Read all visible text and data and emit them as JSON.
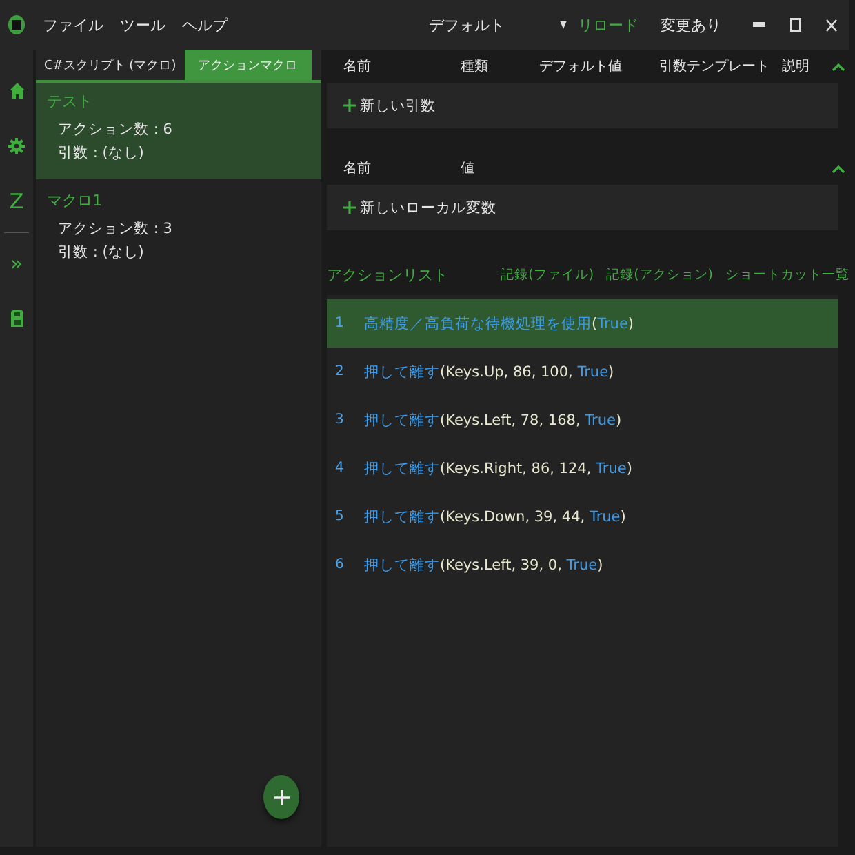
{
  "title_bar": {
    "menu": [
      "ファイル",
      "ツール",
      "ヘルプ"
    ],
    "title": "デフォルト",
    "reload": "リロード",
    "status": "変更あり"
  },
  "rail": [
    {
      "kind": "home"
    },
    {
      "kind": "gear"
    },
    {
      "kind": "letter",
      "text": "Z"
    },
    {
      "kind": "divider"
    },
    {
      "kind": "letter",
      "text": "»"
    },
    {
      "kind": "save"
    }
  ],
  "tabs": [
    {
      "label": "C#スクリプト (マクロ)",
      "selected": false
    },
    {
      "label": "アクションマクロ",
      "selected": true
    }
  ],
  "macros": [
    {
      "name": "テスト",
      "lines": [
        "アクション数 : 6",
        "引数 : (なし)"
      ],
      "selected": true
    },
    {
      "name": "マクロ1",
      "lines": [
        "アクション数 : 3",
        "引数 : (なし)"
      ],
      "selected": false
    }
  ],
  "arguments": {
    "columns": [
      "名前",
      "種類",
      "デフォルト値",
      "引数テンプレート",
      "説明"
    ],
    "expanded": true,
    "add_label": "新しい引数"
  },
  "locals": {
    "columns": [
      "名前",
      "値"
    ],
    "expanded": true,
    "add_label": "新しいローカル変数"
  },
  "action_list": {
    "title": "アクションリスト",
    "links": [
      "記録(ファイル)",
      "記録(アクション)",
      "ショートカット一覧"
    ],
    "items": [
      {
        "number": "1",
        "selected": true,
        "parts": [
          {
            "kind": "method",
            "text": "高精度／高負荷な待機処理を使用"
          },
          {
            "kind": "plain",
            "text": "("
          },
          {
            "kind": "keyword",
            "text": "True"
          },
          {
            "kind": "plain",
            "text": ")"
          }
        ]
      },
      {
        "number": "2",
        "selected": false,
        "parts": [
          {
            "kind": "method",
            "text": "押して離す"
          },
          {
            "kind": "plain",
            "text": "(Keys.Up, 86, 100, "
          },
          {
            "kind": "keyword",
            "text": "True"
          },
          {
            "kind": "plain",
            "text": ")"
          }
        ]
      },
      {
        "number": "3",
        "selected": false,
        "parts": [
          {
            "kind": "method",
            "text": "押して離す"
          },
          {
            "kind": "plain",
            "text": "(Keys.Left, 78, 168, "
          },
          {
            "kind": "keyword",
            "text": "True"
          },
          {
            "kind": "plain",
            "text": ")"
          }
        ]
      },
      {
        "number": "4",
        "selected": false,
        "parts": [
          {
            "kind": "method",
            "text": "押して離す"
          },
          {
            "kind": "plain",
            "text": "(Keys.Right, 86, 124, "
          },
          {
            "kind": "keyword",
            "text": "True"
          },
          {
            "kind": "plain",
            "text": ")"
          }
        ]
      },
      {
        "number": "5",
        "selected": false,
        "parts": [
          {
            "kind": "method",
            "text": "押して離す"
          },
          {
            "kind": "plain",
            "text": "(Keys.Down, 39, 44, "
          },
          {
            "kind": "keyword",
            "text": "True"
          },
          {
            "kind": "plain",
            "text": ")"
          }
        ]
      },
      {
        "number": "6",
        "selected": false,
        "parts": [
          {
            "kind": "method",
            "text": "押して離す"
          },
          {
            "kind": "plain",
            "text": "(Keys.Left, 39, 0, "
          },
          {
            "kind": "keyword",
            "text": "True"
          },
          {
            "kind": "plain",
            "text": ")"
          }
        ]
      }
    ]
  }
}
